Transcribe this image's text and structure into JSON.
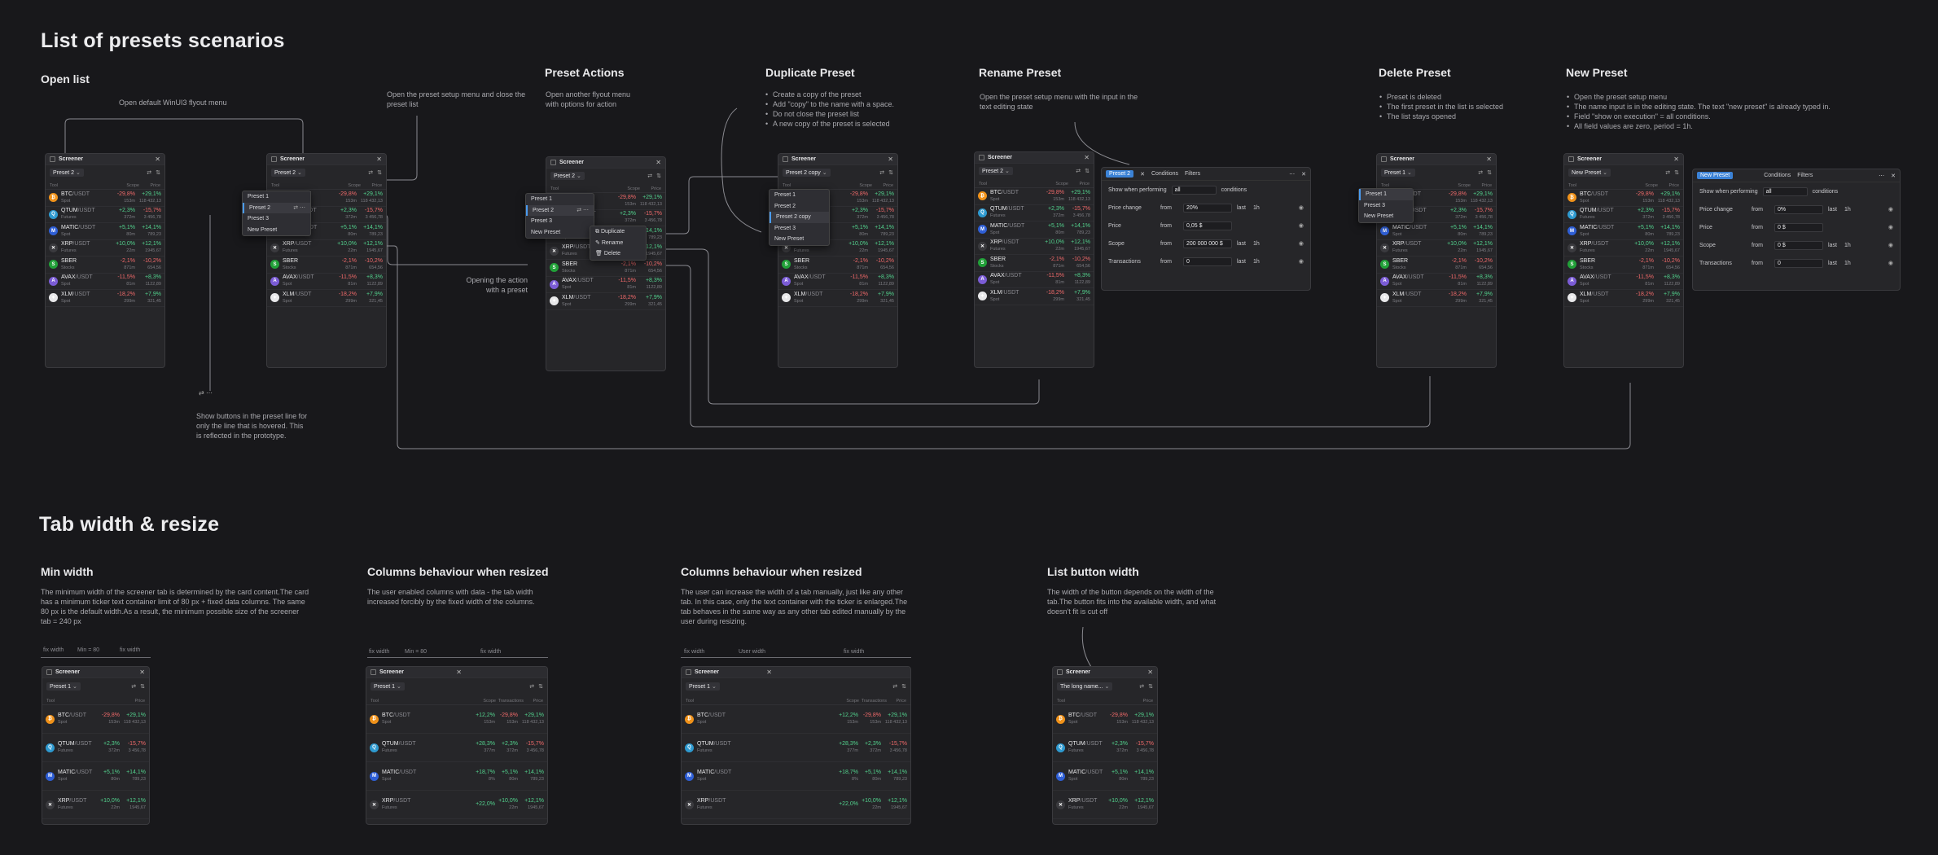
{
  "title": "List of presets scenarios",
  "sections": {
    "open_list": "Open list",
    "preset_actions": "Preset Actions",
    "duplicate": "Duplicate Preset",
    "rename": "Rename Preset",
    "delete": "Delete Preset",
    "new_preset": "New Preset",
    "tab_width": "Tab width & resize",
    "min_width": "Min width",
    "cols1": "Columns behaviour when resized",
    "cols2": "Columns behaviour when resized",
    "list_btn": "List button width"
  },
  "notes": {
    "winui": "Open default WinUI3 flyout menu",
    "setup_menu": "Open the preset setup menu and close the preset list",
    "actions_desc": "Open another flyout menu with options for action",
    "opening_action": "Opening the action with a preset",
    "hover_buttons": "Show buttons in the preset line for only the line that is hovered. This is reflected in the prototype.",
    "duplicate_list": [
      "Create a copy of the preset",
      "Add \"copy\" to the name with a space.",
      "Do not close the preset list",
      "A new copy of the preset is selected"
    ],
    "rename_desc": "Open the preset setup menu with the input in the text editing state",
    "delete_list": [
      "Preset is deleted",
      "The first preset in the list is selected",
      "The list stays opened"
    ],
    "new_list": [
      "Open the preset setup menu",
      "The name input is in the editing state. The text \"new preset\" is already typed in.",
      "Field \"show on execution\" = all conditions.",
      "All field values are zero, period = 1h."
    ],
    "min_width_desc": "The minimum width of the screener tab is determined by the card content.The card has a minimum ticker text container limit of 80 px + fixed data columns. The same 80 px is the default width.As a result, the minimum possible size of the screener tab = 240 px",
    "cols1_desc": "The user enabled columns with data - the tab width increased forcibly by the fixed width of the columns.",
    "cols2_desc": "The user can increase the width of a tab manually, just like any other tab. In this case, only the text container with the ticker is enlarged.The tab behaves in the same way as any other tab edited manually by the user during resizing.",
    "listbtn_desc": "The width of the button depends on the width of the tab.The button fits into the available width, and what doesn't fit is cut off"
  },
  "rulers": {
    "fix": "fix width",
    "min": "Min = 80",
    "user": "User width"
  },
  "screener": {
    "title": "Screener",
    "col_tool": "Tool",
    "col_scope": "Scope",
    "col_vol": "Vol",
    "col_price": "Price",
    "col_transactions": "Transactions",
    "presets": [
      "Preset 1",
      "Preset 2",
      "Preset 3",
      "New Preset"
    ],
    "preset_copy": "Preset 2 copy",
    "long_name": "The long name...",
    "menu_actions": [
      "Duplicate",
      "Rename",
      "Delete"
    ],
    "coins": [
      {
        "sym": "BTC",
        "quote": "/USDT",
        "sub": "Spot",
        "ch": "-29,8%",
        "chv": "153m",
        "pc": "+29,1%",
        "price": "118 432,13",
        "color": "#f0921a",
        "glyph": "₿"
      },
      {
        "sym": "QTUM",
        "quote": "/USDT",
        "sub": "Futures",
        "ch": "+2,3%",
        "chv": "372m",
        "pc": "-15,7%",
        "price": "3 456,78",
        "color": "#2e9ad0",
        "glyph": "Q"
      },
      {
        "sym": "MATIC",
        "quote": "/USDT",
        "sub": "Spot",
        "ch": "+5,1%",
        "chv": "80m",
        "pc": "+14,1%",
        "price": "789,23",
        "color": "#2f5fd6",
        "glyph": "M"
      },
      {
        "sym": "XRP",
        "quote": "/USDT",
        "sub": "Futures",
        "ch": "+10,0%",
        "chv": "22m",
        "pc": "+12,1%",
        "price": "1945,67",
        "color": "#3a3a3e",
        "glyph": "✕"
      },
      {
        "sym": "SBER",
        "quote": "",
        "sub": "Stocks",
        "ch": "-2,1%",
        "chv": "871m",
        "pc": "-10,2%",
        "price": "654,56",
        "color": "#21a038",
        "glyph": "S"
      },
      {
        "sym": "AVAX",
        "quote": "/USDT",
        "sub": "Spot",
        "ch": "-11,5%",
        "chv": "81m",
        "pc": "+8,3%",
        "price": "1122,89",
        "color": "#7b5cd6",
        "glyph": "A"
      },
      {
        "sym": "XLM",
        "quote": "/USDT",
        "sub": "Spot",
        "ch": "-18,2%",
        "chv": "299m",
        "pc": "+7,9%",
        "price": "321,45",
        "color": "#e8e8ea",
        "glyph": "✦"
      }
    ],
    "extra_cols": [
      [
        "+12,2%",
        "153m"
      ],
      [
        "+28,3%",
        "377m"
      ],
      [
        "+18,7%",
        "8%"
      ],
      [
        "+22,0%",
        ""
      ]
    ]
  },
  "conditions": {
    "tab_conditions": "Conditions",
    "tab_filters": "Filters",
    "show_when": "Show when performing",
    "all": "all",
    "conditions_word": "conditions",
    "rows": [
      {
        "label": "Price change",
        "from": "from",
        "val": "20%",
        "last": "last",
        "period": "1h"
      },
      {
        "label": "Price",
        "from": "from",
        "val": "0,05 $",
        "last": "",
        "period": ""
      },
      {
        "label": "Scope",
        "from": "from",
        "val": "200 000 000 $",
        "last": "last",
        "period": "1h"
      },
      {
        "label": "Transactions",
        "from": "from",
        "val": "0",
        "last": "last",
        "period": "1h"
      }
    ],
    "new_rows": [
      {
        "label": "Price change",
        "from": "from",
        "val": "0%",
        "last": "last",
        "period": "1h"
      },
      {
        "label": "Price",
        "from": "from",
        "val": "0 $",
        "last": "",
        "period": ""
      },
      {
        "label": "Scope",
        "from": "from",
        "val": "0 $",
        "last": "last",
        "period": "1h"
      },
      {
        "label": "Transactions",
        "from": "from",
        "val": "0",
        "last": "last",
        "period": "1h"
      }
    ]
  }
}
